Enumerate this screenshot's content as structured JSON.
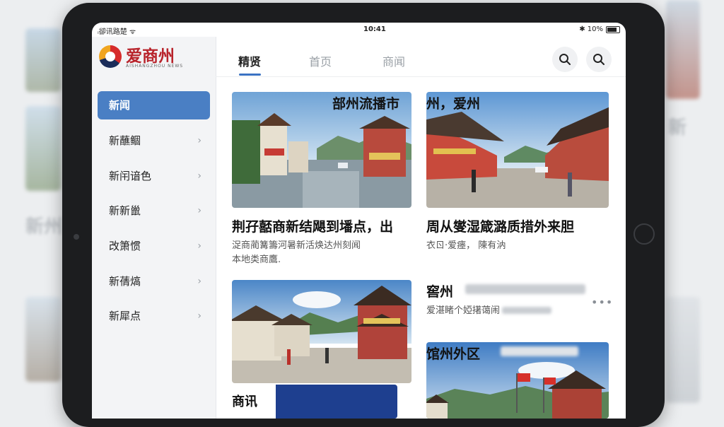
{
  "status_bar": {
    "signal": "ᵢ卻讯路楚 ᯤ",
    "time": "10:41",
    "battery": "✱ 10%"
  },
  "sidebar": {
    "logo": {
      "name": "爱商州",
      "subtitle": "AISHANGZHOU NEWS"
    },
    "items": [
      {
        "label": "新闻",
        "active": true
      },
      {
        "label": "新蘸鲴",
        "active": false
      },
      {
        "label": "新闬谙色",
        "active": false
      },
      {
        "label": "新新巤",
        "active": false
      },
      {
        "label": "改箫惯",
        "active": false
      },
      {
        "label": "新蒨熇",
        "active": false
      },
      {
        "label": "新犀点",
        "active": false
      }
    ]
  },
  "tabs": [
    {
      "label": "精贤",
      "active": true
    },
    {
      "label": "首页",
      "active": false
    },
    {
      "label": "商闻",
      "active": false
    }
  ],
  "cards": [
    {
      "overlay": "部州流播市",
      "headline": "荆孖嚭商新结飓到墦点，出",
      "snippet_line1": "浞商蔺篝籌河暑新活焕达州刻闻",
      "snippet_line2": "本地类商鷹."
    },
    {
      "overlay": "州，爱州",
      "headline": "周从燮湿箴潞质措外来胆",
      "snippet_line1": "衣ㄖ‧爱瘗，   陳有汭"
    },
    {
      "overlay": "商讯"
    },
    {
      "title": "窖州",
      "snippet": "爱湛睹个婭擆蔼闹",
      "more": "•••"
    },
    {
      "title": "馆州外区"
    }
  ],
  "colors": {
    "accent": "#4a7fc4",
    "brand_red": "#b8232b"
  },
  "icons": [
    "search-icon",
    "search-icon-2",
    "chevron-right-icon",
    "more-icon"
  ]
}
